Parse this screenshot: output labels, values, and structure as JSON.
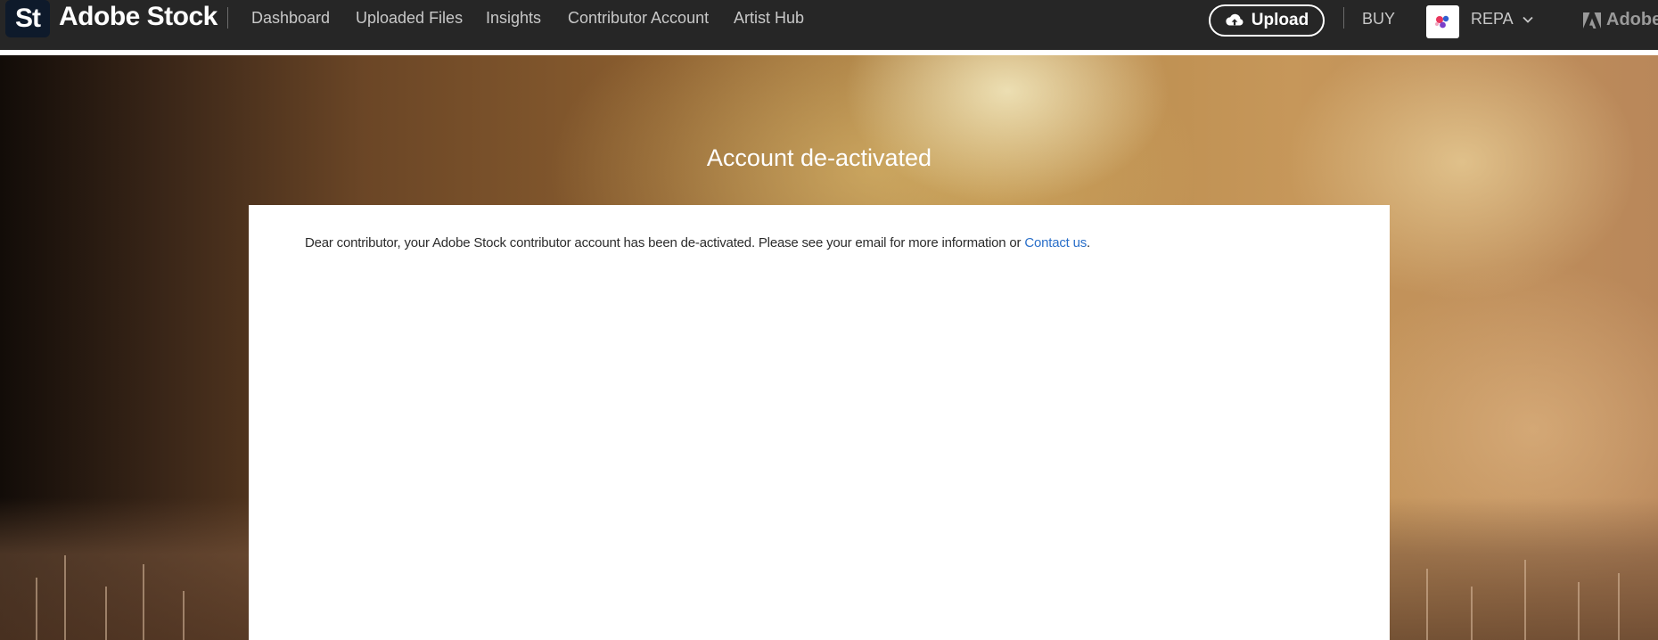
{
  "header": {
    "logo_text": "St",
    "brand_name": "Adobe Stock",
    "nav": [
      {
        "label": "Dashboard"
      },
      {
        "label": "Uploaded Files"
      },
      {
        "label": "Insights"
      },
      {
        "label": "Contributor Account"
      },
      {
        "label": "Artist Hub"
      }
    ],
    "upload_label": "Upload",
    "upload_icon": "cloud-upload-icon",
    "buy_label": "BUY",
    "user_label": "REPA",
    "adobe_label": "Adobe"
  },
  "main": {
    "title": "Account de-activated",
    "message": "Dear contributor, your Adobe Stock contributor account has been de-activated. Please see your email for more information or ",
    "contact_link": "Contact us",
    "message_end": "."
  },
  "colors": {
    "topbar": "#262626",
    "link": "#2a6fc9"
  }
}
